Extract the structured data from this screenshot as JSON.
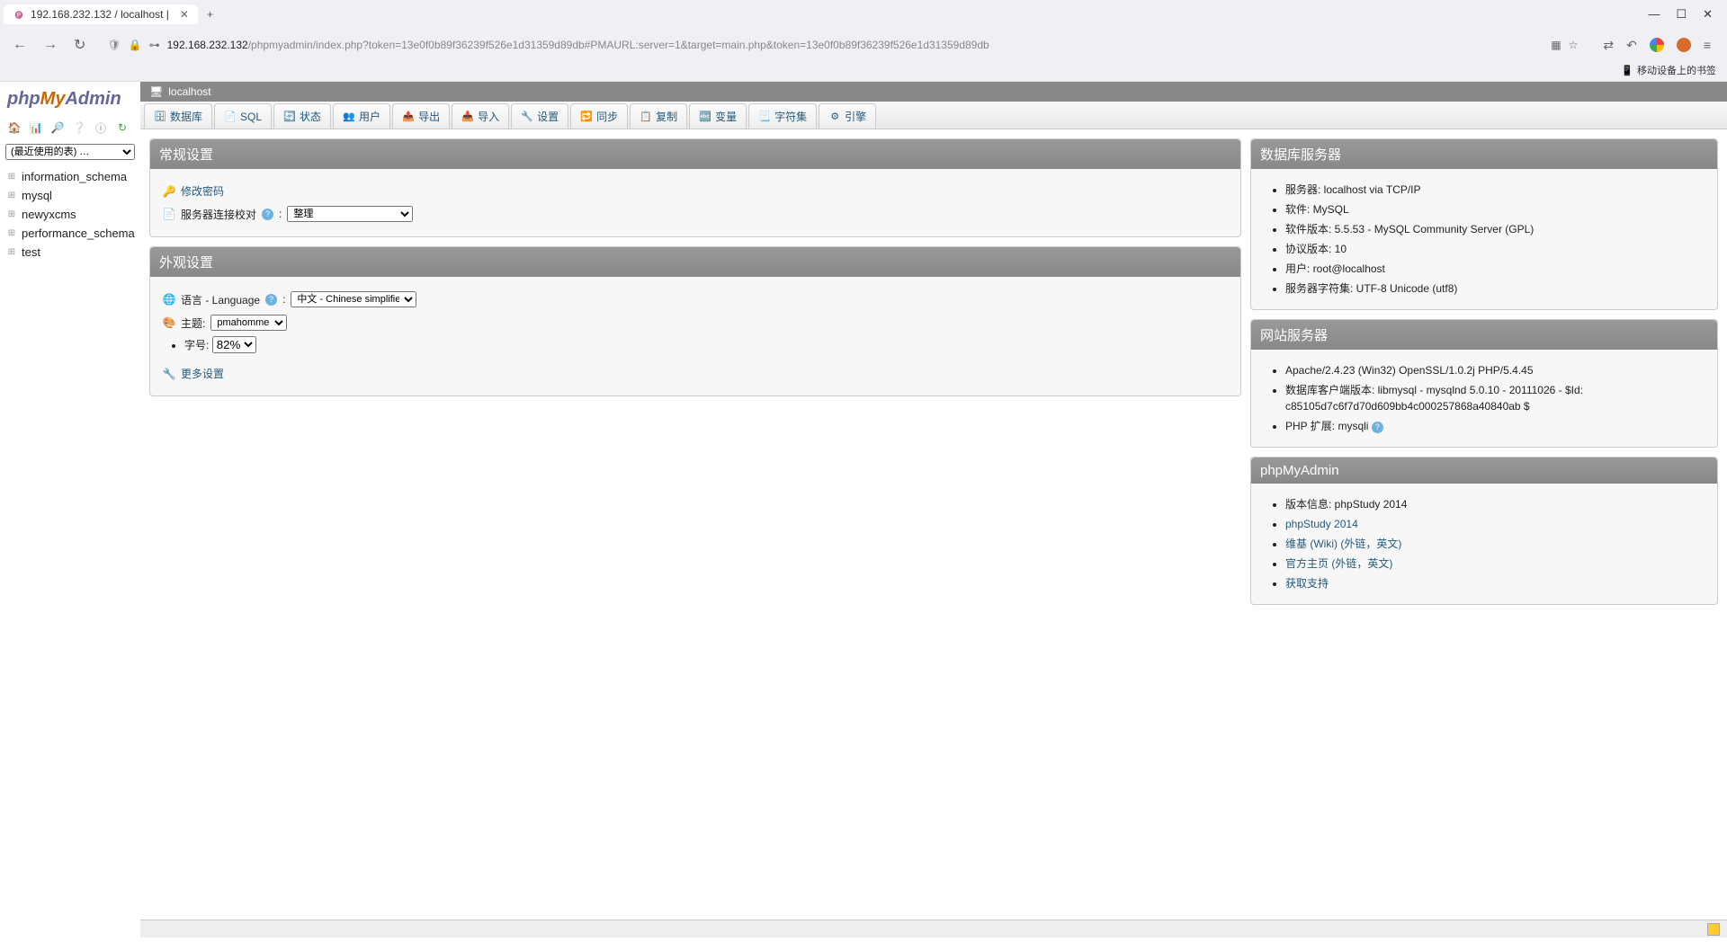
{
  "browser": {
    "tab_title": "192.168.232.132 / localhost |",
    "url_host": "192.168.232.132",
    "url_path": "/phpmyadmin/index.php?token=13e0f0b89f36239f526e1d31359d89db#PMAURL:server=1&target=main.php&token=13e0f0b89f36239f526e1d31359d89db",
    "bookmark_mobile": "移动设备上的书签"
  },
  "sidebar": {
    "recent_label": "(最近使用的表) …",
    "databases": [
      "information_schema",
      "mysql",
      "newyxcms",
      "performance_schema",
      "test"
    ]
  },
  "breadcrumb": "localhost",
  "tabs": [
    {
      "icon": "database-icon",
      "glyph": "🗄",
      "label": "数据库"
    },
    {
      "icon": "sql-icon",
      "glyph": "📄",
      "label": "SQL"
    },
    {
      "icon": "status-icon",
      "glyph": "🔄",
      "label": "状态"
    },
    {
      "icon": "users-icon",
      "glyph": "👥",
      "label": "用户"
    },
    {
      "icon": "export-icon",
      "glyph": "📤",
      "label": "导出"
    },
    {
      "icon": "import-icon",
      "glyph": "📥",
      "label": "导入"
    },
    {
      "icon": "settings-icon",
      "glyph": "🔧",
      "label": "设置"
    },
    {
      "icon": "sync-icon",
      "glyph": "🔁",
      "label": "同步"
    },
    {
      "icon": "replication-icon",
      "glyph": "📋",
      "label": "复制"
    },
    {
      "icon": "variables-icon",
      "glyph": "🔤",
      "label": "变量"
    },
    {
      "icon": "charset-icon",
      "glyph": "📃",
      "label": "字符集"
    },
    {
      "icon": "engines-icon",
      "glyph": "⚙",
      "label": "引擎"
    }
  ],
  "general": {
    "title": "常规设置",
    "change_pw_label": "修改密码",
    "collation_label": "服务器连接校对",
    "collation_value": "整理"
  },
  "appearance": {
    "title": "外观设置",
    "language_label": "语言 - Language",
    "language_value": "中文 - Chinese simplified",
    "theme_label": "主题:",
    "theme_value": "pmahomme",
    "fontsize_label": "字号:",
    "fontsize_value": "82%",
    "more_settings": "更多设置"
  },
  "dbserver": {
    "title": "数据库服务器",
    "items": [
      "服务器: localhost via TCP/IP",
      "软件: MySQL",
      "软件版本: 5.5.53 - MySQL Community Server (GPL)",
      "协议版本: 10",
      "用户: root@localhost",
      "服务器字符集: UTF-8 Unicode (utf8)"
    ]
  },
  "webserver": {
    "title": "网站服务器",
    "items": [
      "Apache/2.4.23 (Win32) OpenSSL/1.0.2j PHP/5.4.45",
      "数据库客户端版本: libmysql - mysqlnd 5.0.10 - 20111026 - $Id: c85105d7c6f7d70d609bb4c000257868a40840ab $",
      "PHP 扩展: mysqli"
    ]
  },
  "pma_info": {
    "title": "phpMyAdmin",
    "version_label": "版本信息: phpStudy 2014",
    "links": [
      "phpStudy 2014",
      "维基 (Wiki) (外链，英文)",
      "官方主页 (外链，英文)",
      "获取支持"
    ]
  }
}
